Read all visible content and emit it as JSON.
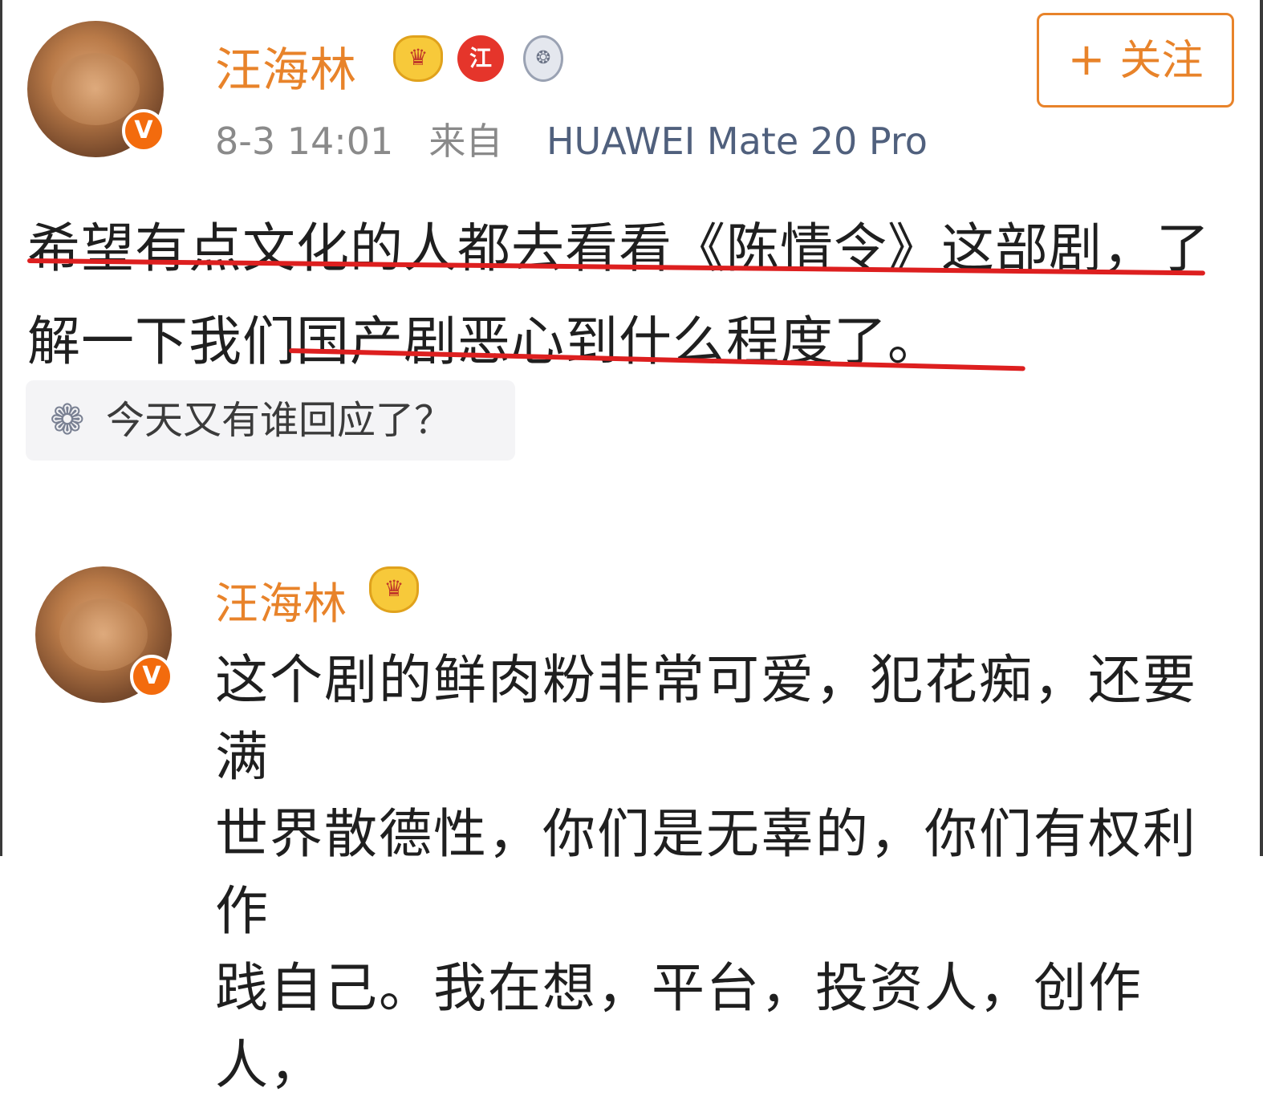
{
  "post": {
    "username": "汪海林",
    "badges": {
      "crown": "crown-badge-icon",
      "red": "江",
      "medal": "medal-icon"
    },
    "verified_mark": "V",
    "follow_plus": "+",
    "follow_label": "关注",
    "time": "8-3 14:01",
    "from_label": "来自",
    "device": "HUAWEI Mate 20 Pro",
    "text_line1": "希望有点文化的人都去看看《陈情令》这部剧，了",
    "text_line2": "解一下我们国产剧恶心到什么程度了。",
    "topic_text": "今天又有谁回应了？"
  },
  "reply": {
    "username": "汪海林",
    "verified_mark": "V",
    "text_line1": "这个剧的鲜肉粉非常可爱，犯花痴，还要满",
    "text_line2": "世界散德性，你们是无辜的，你们有权利作",
    "text_line3": "践自己。我在想，平台，投资人，创作人，"
  },
  "colors": {
    "accent": "#e8832a",
    "underline": "#dd1f1f",
    "device": "#50607d"
  }
}
